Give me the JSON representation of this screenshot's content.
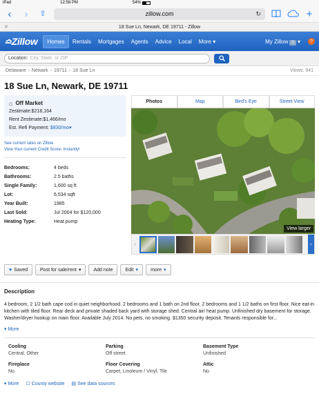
{
  "status_bar": {
    "device": "iPad",
    "time": "12:58 PM",
    "battery": "54%",
    "battery_level": 0.54
  },
  "browser": {
    "url": "zillow.com",
    "tab_title": "18 Sue Ln, Newark, DE 19711 - Zillow"
  },
  "nav": {
    "logo": "Zillow",
    "items": [
      "Homes",
      "Rentals",
      "Mortgages",
      "Agents",
      "Advice",
      "Local",
      "More ▾"
    ],
    "my_zillow": "My Zillow",
    "badge": "0",
    "help": "?"
  },
  "location": {
    "label": "Location:",
    "placeholder": "City, State, or ZIP"
  },
  "breadcrumb": {
    "items": [
      "Delaware",
      "Newark",
      "19711",
      "18 Sue Ln"
    ],
    "views": "Views: 941"
  },
  "address": "18 Sue Ln, Newark, DE 19711",
  "market": {
    "status": "Off Market",
    "zestimate": "Zestimate:$218,164",
    "rent_zestimate": "Rent Zestimate:$1,466/mo",
    "refi_label": "Est. Refi Payment: ",
    "refi_value": "$830/mo"
  },
  "links": {
    "rates": "See current rates on Zillow",
    "credit": "View Your current Credit Score- Instantly!"
  },
  "facts": [
    {
      "k": "Bedrooms:",
      "v": "4 beds"
    },
    {
      "k": "Bathrooms:",
      "v": "2.5 baths"
    },
    {
      "k": "Single Family:",
      "v": "1,600 sq ft"
    },
    {
      "k": "Lot:",
      "v": "6,534 sqft"
    },
    {
      "k": "Year Built:",
      "v": "1985"
    },
    {
      "k": "Last Sold:",
      "v": "Jul 2004 for $120,000"
    },
    {
      "k": "Heating Type:",
      "v": "Heat pump"
    }
  ],
  "photo_tabs": [
    "Photos",
    "Map",
    "Bird's Eye",
    "Street View"
  ],
  "view_larger": "View larger",
  "actions": {
    "saved": "Saved",
    "sale": "Post for sale/rent",
    "note": "Add note",
    "edit": "Edit",
    "more": "more"
  },
  "description": {
    "heading": "Description",
    "text": "4 bedroom, 2 1/2 bath cape cod in quiet neighborhood. 2 bedrooms and 1 bath on 2nd floor, 2 bedrooms and 1 1/2 baths on first floor. Nice eat-in kitchen with tiled floor. Rear deck and private shaded back yard with storage shed. Central air/ heat pump. Unfinished dry basement for storage. Washer/dryer hookup on main floor. Available July 2014. No pets, no smoking. $1350 security deposit. Tenants responsible for...",
    "more": "More"
  },
  "details": [
    {
      "k": "Cooling",
      "v": "Central, Other"
    },
    {
      "k": "Parking",
      "v": "Off street"
    },
    {
      "k": "Basement Type",
      "v": "Unfinished"
    },
    {
      "k": "Fireplace",
      "v": "No"
    },
    {
      "k": "Floor Covering",
      "v": "Carpet, Linoleum / Vinyl, Tile"
    },
    {
      "k": "Attic",
      "v": "No"
    }
  ],
  "footer": {
    "more": "More",
    "county": "County website",
    "sources": "See data sources"
  },
  "colors": {
    "brand": "#1f63bf",
    "nav_gradient_top": "#3b7ed6",
    "help": "#e86b2b"
  }
}
